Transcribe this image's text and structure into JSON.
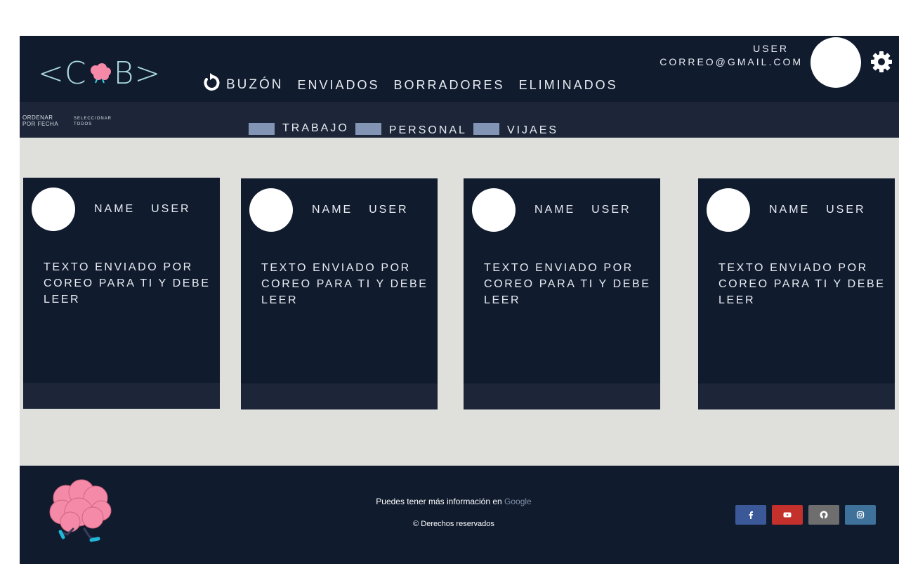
{
  "header": {
    "logo": {
      "left": "<C",
      "right": "B>"
    },
    "nav": [
      {
        "label": "BUZÓN",
        "active": true
      },
      {
        "label": "ENVIADOS"
      },
      {
        "label": "BORRADORES"
      },
      {
        "label": "ELIMINADOS"
      }
    ],
    "user": {
      "name": "USER",
      "email": "CORREO@GMAIL.COM"
    },
    "icons": {
      "refresh": "refresh-icon",
      "settings": "gear-icon"
    }
  },
  "subbar": {
    "sort": {
      "line1": "ORDENAR",
      "line2": "POR FECHA"
    },
    "select": {
      "line1": "SELECCIONAR",
      "line2": "TODOS"
    },
    "labels": [
      {
        "text": "TRABAJO",
        "color": "#8295b5"
      },
      {
        "text": "PERSONAL",
        "color": "#8295b5"
      },
      {
        "text": "VIJAES",
        "color": "#8295b5"
      }
    ]
  },
  "cards": [
    {
      "name": "NAME  USER",
      "text": "TEXTO ENVIADO POR COREO PARA TI Y DEBE LEER"
    },
    {
      "name": "NAME  USER",
      "text": "TEXTO ENVIADO POR COREO PARA TI Y DEBE LEER"
    },
    {
      "name": "NAME  USER",
      "text": "TEXTO ENVIADO POR COREO PARA TI Y DEBE LEER"
    },
    {
      "name": "NAME  USER",
      "text": "TEXTO ENVIADO POR COREO PARA TI Y DEBE LEER"
    }
  ],
  "footer": {
    "info_prefix": "Puedes tener más información en ",
    "info_link": "Google",
    "copyright": "© Derechos reservados",
    "social": [
      {
        "name": "facebook-icon",
        "color": "#3b5998"
      },
      {
        "name": "youtube-icon",
        "color": "#c4302b"
      },
      {
        "name": "github-icon",
        "color": "#6e6e6e"
      },
      {
        "name": "instagram-icon",
        "color": "#3f729b"
      }
    ]
  },
  "colors": {
    "dark": "#101b2e",
    "darker_bar": "#1d2638",
    "background": "#dfdfdb",
    "logo": "#a9d7e0",
    "brain_pink": "#f48aa8"
  }
}
